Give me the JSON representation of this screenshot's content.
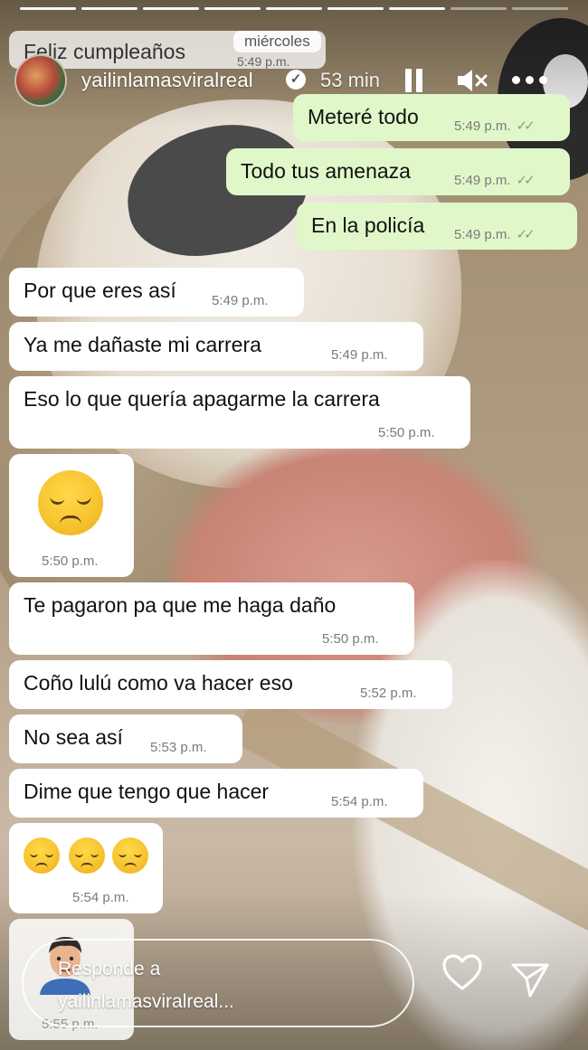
{
  "story": {
    "progress_total": 9,
    "progress_completed": 7
  },
  "header": {
    "prev_message": "Feliz cumpleaños",
    "prev_time": "5:49 p.m.",
    "day_label": "miércoles",
    "username": "yailinlamasviralreal",
    "verified_icon": "verified-badge-icon",
    "time_ago": "53 min"
  },
  "messages": [
    {
      "dir": "out",
      "text": "Meteré todo",
      "time": "5:49 p.m."
    },
    {
      "dir": "out",
      "text": "Todo tus amenaza",
      "time": "5:49 p.m."
    },
    {
      "dir": "out",
      "text": "En la policía",
      "time": "5:49 p.m."
    },
    {
      "dir": "in",
      "text": "Por que eres así",
      "time": "5:49 p.m."
    },
    {
      "dir": "in",
      "text": "Ya me dañaste mi carrera",
      "time": "5:49 p.m."
    },
    {
      "dir": "in",
      "text": "Eso lo que quería apagarme la carrera",
      "time": "5:50 p.m."
    },
    {
      "dir": "in",
      "emoji": "disappointed-face",
      "count": 1,
      "time": "5:50 p.m."
    },
    {
      "dir": "in",
      "text": "Te pagaron pa que me haga daño",
      "time": "5:50 p.m."
    },
    {
      "dir": "in",
      "text": "Coño lulú como va hacer eso",
      "time": "5:52 p.m."
    },
    {
      "dir": "in",
      "text": "No sea así",
      "time": "5:53 p.m."
    },
    {
      "dir": "in",
      "text": "Dime que tengo que hacer",
      "time": "5:54 p.m."
    },
    {
      "dir": "in",
      "emoji": "disappointed-face",
      "count": 3,
      "time": "5:54 p.m."
    },
    {
      "dir": "in",
      "emoji": "memoji-man",
      "count": 1,
      "time": "5:55 p.m."
    }
  ],
  "reply": {
    "line1": "Responde a",
    "line2": "yailinlamasviralreal..."
  },
  "colors": {
    "outgoing_bubble": "#e0f8c9",
    "incoming_bubble": "#ffffff"
  }
}
